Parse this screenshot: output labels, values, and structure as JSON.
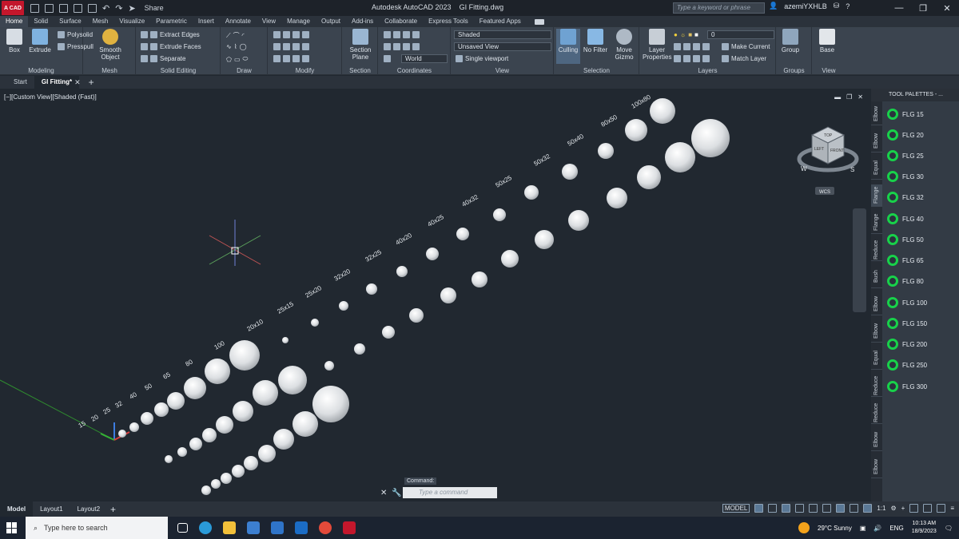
{
  "window": {
    "app_title": "Autodesk AutoCAD 2023",
    "file_title": "GI Fitting.dwg",
    "logo_text": "A CAD",
    "share_label": "Share",
    "search_placeholder": "Type a keyword or phrase",
    "user": "azemiYXHLB"
  },
  "ribbon_tabs": [
    "Home",
    "Solid",
    "Surface",
    "Mesh",
    "Visualize",
    "Parametric",
    "Insert",
    "Annotate",
    "View",
    "Manage",
    "Output",
    "Add-ins",
    "Collaborate",
    "Express Tools",
    "Featured Apps"
  ],
  "ribbon": {
    "modeling": {
      "title": "Modeling",
      "box": "Box",
      "extrude": "Extrude",
      "polysolid": "Polysolid",
      "presspull": "Presspull"
    },
    "mesh": {
      "title": "Mesh",
      "smooth": "Smooth Object"
    },
    "solid_editing": {
      "title": "Solid Editing",
      "extract_edges": "Extract Edges",
      "extrude_faces": "Extrude Faces",
      "separate": "Separate"
    },
    "draw": {
      "title": "Draw"
    },
    "modify": {
      "title": "Modify"
    },
    "section": {
      "title": "Section",
      "section_plane": "Section Plane"
    },
    "coordinates": {
      "title": "Coordinates",
      "ucs": "World"
    },
    "view": {
      "title": "View",
      "visual_style": "Shaded",
      "named_view": "Unsaved View",
      "viewport": "Single viewport"
    },
    "selection": {
      "title": "Selection",
      "culling": "Culling",
      "no_filter": "No Filter",
      "move_gizmo": "Move Gizmo"
    },
    "layers": {
      "title": "Layers",
      "layer_properties": "Layer Properties",
      "layer_value": "0",
      "make_current": "Make Current",
      "match_layer": "Match Layer"
    },
    "groups": {
      "title": "Groups",
      "group": "Group"
    },
    "view2": {
      "title": "View",
      "base": "Base"
    }
  },
  "doc_tabs": [
    "Start",
    "GI Fitting*"
  ],
  "viewport": {
    "label": "[−][Custom View][Shaded (Fast)]",
    "viewcube": {
      "top": "TOP",
      "left": "LEFT",
      "front": "FRONT",
      "west": "W",
      "south": "S",
      "wcs": "WCS"
    },
    "size_labels_row1": [
      "15",
      "20",
      "25",
      "32",
      "40",
      "50",
      "65",
      "80",
      "100"
    ],
    "size_labels_row2": [
      "20x10",
      "25x15",
      "25x20",
      "32x20",
      "32x25",
      "40x20",
      "40x25",
      "40x32",
      "50x25",
      "50x32",
      "50x40",
      "80x50",
      "100x80"
    ]
  },
  "tool_palette": {
    "title": "TOOL PALETTES - ...",
    "side_tabs": [
      "Elbow",
      "Elbow",
      "Equal",
      "Flange",
      "Flange",
      "Reduce",
      "Bush",
      "Elbow",
      "Elbow",
      "Equal",
      "Reduce",
      "Reduce",
      "Elbow",
      "Elbow"
    ],
    "items": [
      "FLG 15",
      "FLG 20",
      "FLG 25",
      "FLG 30",
      "FLG 32",
      "FLG 40",
      "FLG 50",
      "FLG 65",
      "FLG 80",
      "FLG 100",
      "FLG 150",
      "FLG 200",
      "FLG 250",
      "FLG 300"
    ],
    "icon_color": "#18d14a"
  },
  "command": {
    "label": "Command:",
    "placeholder": "Type a command"
  },
  "status": {
    "layout_tabs": [
      "Model",
      "Layout1",
      "Layout2"
    ],
    "mode": "MODEL",
    "scale": "1:1"
  },
  "taskbar": {
    "search": "Type here to search",
    "weather": "29°C Sunny",
    "lang": "ENG",
    "time": "10:13 AM",
    "date": "18/9/2023"
  }
}
